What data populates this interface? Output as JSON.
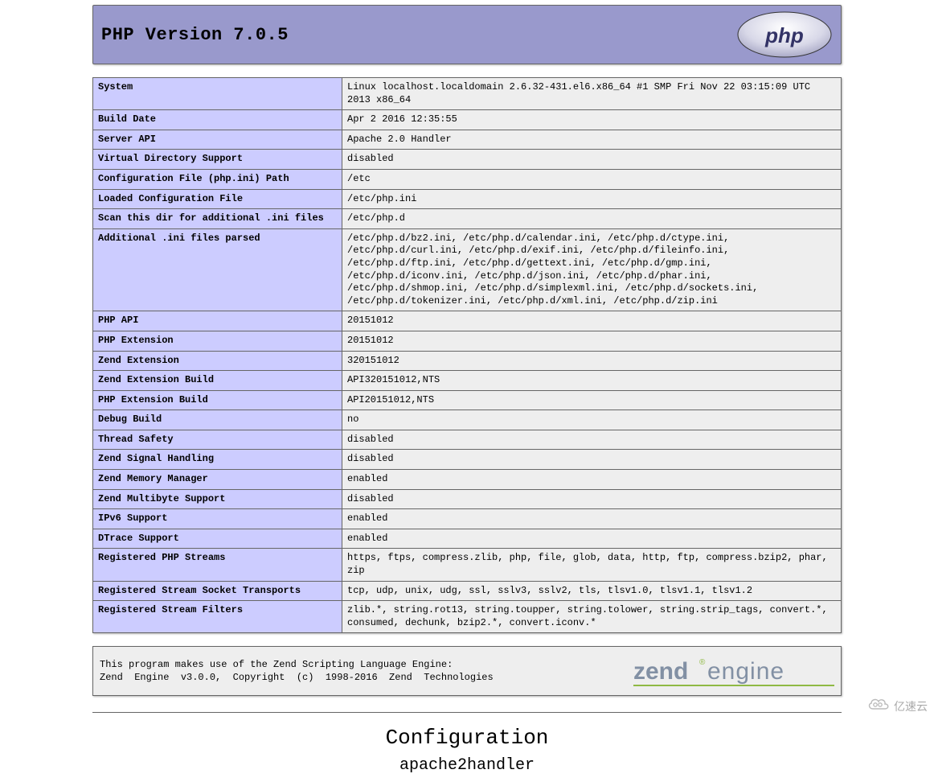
{
  "header": {
    "title": "PHP Version 7.0.5"
  },
  "info": [
    {
      "key": "System",
      "val": "Linux localhost.localdomain 2.6.32-431.el6.x86_64 #1 SMP Fri Nov 22 03:15:09 UTC 2013 x86_64"
    },
    {
      "key": "Build Date",
      "val": "Apr 2 2016 12:35:55"
    },
    {
      "key": "Server API",
      "val": "Apache 2.0 Handler"
    },
    {
      "key": "Virtual Directory Support",
      "val": "disabled"
    },
    {
      "key": "Configuration File (php.ini) Path",
      "val": "/etc"
    },
    {
      "key": "Loaded Configuration File",
      "val": "/etc/php.ini"
    },
    {
      "key": "Scan this dir for additional .ini files",
      "val": "/etc/php.d"
    },
    {
      "key": "Additional .ini files parsed",
      "val": "/etc/php.d/bz2.ini, /etc/php.d/calendar.ini, /etc/php.d/ctype.ini, /etc/php.d/curl.ini, /etc/php.d/exif.ini, /etc/php.d/fileinfo.ini, /etc/php.d/ftp.ini, /etc/php.d/gettext.ini, /etc/php.d/gmp.ini, /etc/php.d/iconv.ini, /etc/php.d/json.ini, /etc/php.d/phar.ini, /etc/php.d/shmop.ini, /etc/php.d/simplexml.ini, /etc/php.d/sockets.ini, /etc/php.d/tokenizer.ini, /etc/php.d/xml.ini, /etc/php.d/zip.ini"
    },
    {
      "key": "PHP API",
      "val": "20151012"
    },
    {
      "key": "PHP Extension",
      "val": "20151012"
    },
    {
      "key": "Zend Extension",
      "val": "320151012"
    },
    {
      "key": "Zend Extension Build",
      "val": "API320151012,NTS"
    },
    {
      "key": "PHP Extension Build",
      "val": "API20151012,NTS"
    },
    {
      "key": "Debug Build",
      "val": "no"
    },
    {
      "key": "Thread Safety",
      "val": "disabled"
    },
    {
      "key": "Zend Signal Handling",
      "val": "disabled"
    },
    {
      "key": "Zend Memory Manager",
      "val": "enabled"
    },
    {
      "key": "Zend Multibyte Support",
      "val": "disabled"
    },
    {
      "key": "IPv6 Support",
      "val": "enabled"
    },
    {
      "key": "DTrace Support",
      "val": "enabled"
    },
    {
      "key": "Registered PHP Streams",
      "val": "https, ftps, compress.zlib, php, file, glob, data, http, ftp, compress.bzip2, phar, zip"
    },
    {
      "key": "Registered Stream Socket Transports",
      "val": "tcp, udp, unix, udg, ssl, sslv3, sslv2, tls, tlsv1.0, tlsv1.1, tlsv1.2"
    },
    {
      "key": "Registered Stream Filters",
      "val": "zlib.*, string.rot13, string.toupper, string.tolower, string.strip_tags, convert.*, consumed, dechunk, bzip2.*, convert.iconv.*"
    }
  ],
  "zend": {
    "line1": "This program makes use of the Zend Scripting Language Engine:",
    "line2": "Zend  Engine  v3.0.0,  Copyright  (c)  1998-2016  Zend  Technologies"
  },
  "sections": {
    "config_heading": "Configuration",
    "module_heading": "apache2handler"
  },
  "watermark": {
    "text": "亿速云"
  }
}
